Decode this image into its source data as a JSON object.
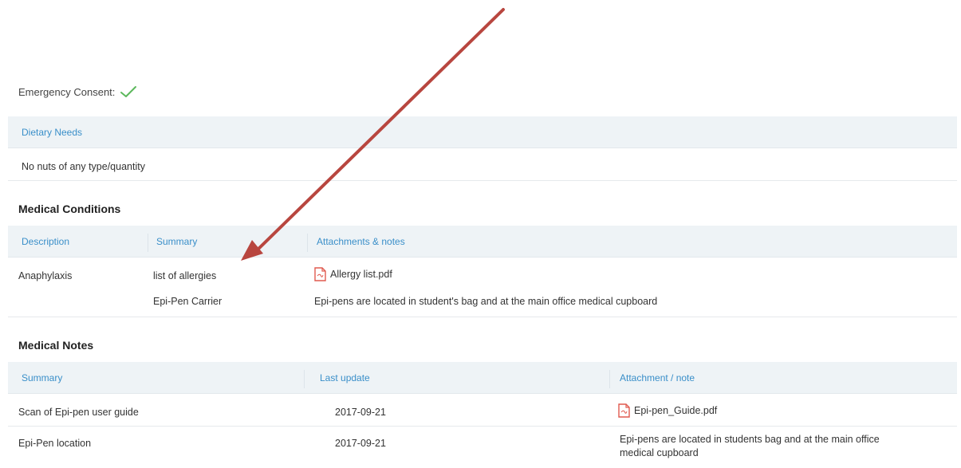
{
  "emergency_consent": {
    "label": "Emergency Consent:",
    "icon": "checkmark-icon",
    "check_color": "#5cb85c"
  },
  "dietary": {
    "header": "Dietary Needs",
    "value": "No nuts of any type/quantity"
  },
  "medical_conditions": {
    "title": "Medical Conditions",
    "columns": [
      "Description",
      "Summary",
      "Attachments & notes"
    ],
    "rows": [
      {
        "description": "Anaphylaxis",
        "summary": "list of allergies",
        "attachment": "Allergy list.pdf",
        "attachment_icon": "pdf-icon"
      },
      {
        "description": "",
        "summary": "Epi-Pen Carrier",
        "note": "Epi-pens are located in student's bag and at the main office medical cupboard"
      }
    ]
  },
  "medical_notes": {
    "title": "Medical Notes",
    "columns": [
      "Summary",
      "Last update",
      "Attachment / note"
    ],
    "rows": [
      {
        "summary": "Scan of Epi-pen user guide",
        "last_update": "2017-09-21",
        "attachment": "Epi-pen_Guide.pdf",
        "attachment_icon": "pdf-icon"
      },
      {
        "summary": "Epi-Pen location",
        "last_update": "2017-09-21",
        "note_line1": "Epi-pens are located in students bag and at the main office",
        "note_line2": "medical cupboard"
      }
    ]
  },
  "colors": {
    "header_text": "#3a8fc9",
    "header_bg": "#eef3f6",
    "arrow": "#b8463f",
    "pdf": "#e05a4f"
  }
}
